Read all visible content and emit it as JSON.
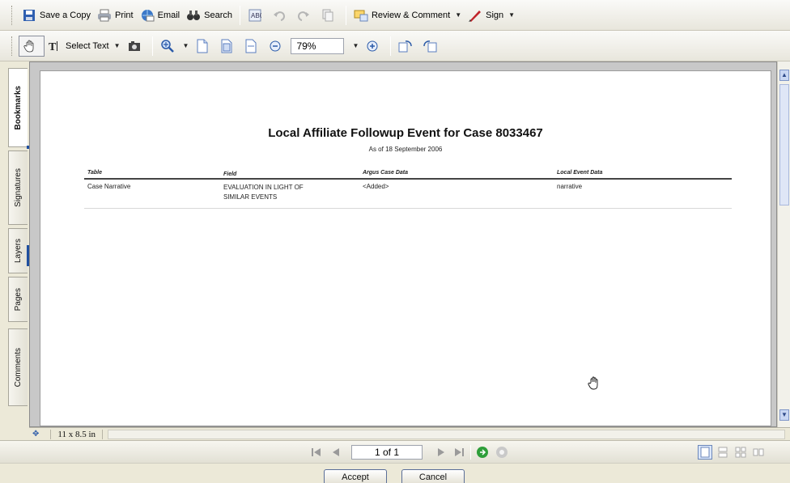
{
  "toolbar_top": {
    "save_copy": "Save a Copy",
    "print": "Print",
    "email": "Email",
    "search": "Search",
    "review_comment": "Review & Comment",
    "sign": "Sign"
  },
  "toolbar_second": {
    "select_text": "Select Text",
    "zoom_value": "79%"
  },
  "left_tabs": [
    "Bookmarks",
    "Signatures",
    "Layers",
    "Pages",
    "Comments"
  ],
  "document": {
    "title": "Local Affiliate Followup Event for Case 8033467",
    "subtitle": "As of 18 September 2006",
    "columns": [
      "Table",
      "Field",
      "Argus Case Data",
      "Local Event Data"
    ],
    "rows": [
      {
        "table": "Case Narrative",
        "field_line1": "EVALUATION IN LIGHT OF",
        "field_line2": "SIMILAR EVENTS",
        "argus": "<Added>",
        "local": "narrative"
      }
    ]
  },
  "status": {
    "page_size": "11 x 8.5 in"
  },
  "navigation": {
    "page_indicator": "1 of 1"
  },
  "dialog": {
    "accept": "Accept",
    "cancel": "Cancel"
  },
  "colors": {
    "accent": "#1f4f9f",
    "dialog_bg": "#ece9d8"
  }
}
